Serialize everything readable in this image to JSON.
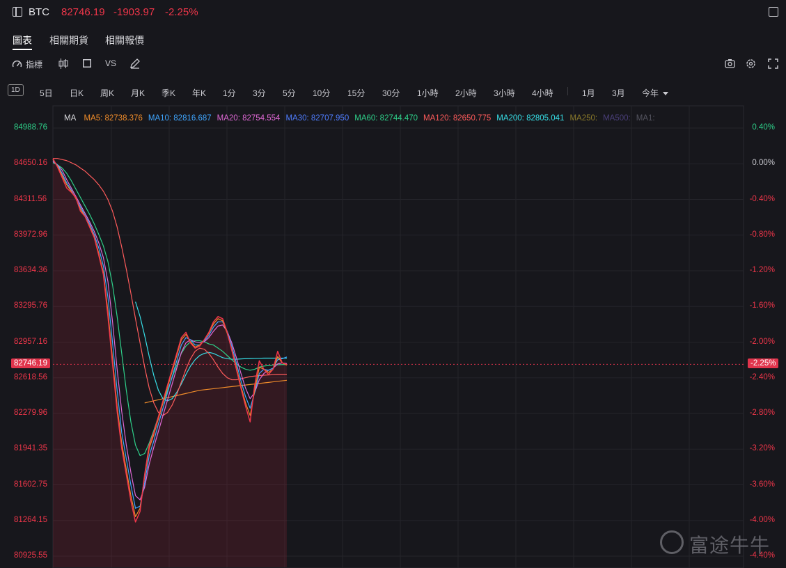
{
  "header": {
    "symbol": "BTC",
    "price": "82746.19",
    "change": "-1903.97",
    "change_pct": "-2.25%"
  },
  "tabs": [
    {
      "label": "圖表",
      "active": true
    },
    {
      "label": "相關期貨",
      "active": false
    },
    {
      "label": "相關報價",
      "active": false
    }
  ],
  "toolbar": {
    "indicator_label": "指標",
    "vs_label": "VS",
    "icons": [
      "candles-icon",
      "square-icon",
      "pen-icon",
      "camera-icon",
      "gear-icon",
      "fullscreen-icon"
    ]
  },
  "periods": [
    "1D",
    "5日",
    "日K",
    "周K",
    "月K",
    "季K",
    "年K",
    "1分",
    "3分",
    "5分",
    "10分",
    "15分",
    "30分",
    "1小時",
    "2小時",
    "3小時",
    "4小時",
    "1月",
    "3月",
    "今年"
  ],
  "legend": {
    "title": "MA",
    "items": [
      {
        "label": "MA5: 82738.376",
        "color": "#f08c2a"
      },
      {
        "label": "MA10: 82816.687",
        "color": "#3fa6ff"
      },
      {
        "label": "MA20: 82754.554",
        "color": "#e069d6"
      },
      {
        "label": "MA30: 82707.950",
        "color": "#4f7dff"
      },
      {
        "label": "MA60: 82744.470",
        "color": "#2ed18a"
      },
      {
        "label": "MA120: 82650.775",
        "color": "#ff5b5b"
      },
      {
        "label": "MA200: 82805.041",
        "color": "#37e0e8"
      },
      {
        "label": "MA250:",
        "color": "#8a7a2a"
      },
      {
        "label": "MA500:",
        "color": "#4a3f7a"
      },
      {
        "label": "MA1:",
        "color": "#555560"
      }
    ]
  },
  "current_price_tag": "82746.19",
  "current_pct_tag": "-2.25%",
  "watermark": "富途牛牛",
  "chart_data": {
    "type": "line",
    "ylim": [
      80925.55,
      84988.76
    ],
    "y_ticks_left": [
      "84988.76",
      "84650.16",
      "84311.56",
      "83972.96",
      "83634.36",
      "83295.76",
      "82957.16",
      "82618.56",
      "82279.96",
      "81941.35",
      "81602.75",
      "81264.15",
      "80925.55"
    ],
    "y_ticks_right": [
      "0.40%",
      "0.00%",
      "-0.40%",
      "-0.80%",
      "-1.20%",
      "-1.60%",
      "-2.00%",
      "-2.40%",
      "-2.80%",
      "-3.20%",
      "-3.60%",
      "-4.00%",
      "-4.40%"
    ],
    "colors": {
      "up": "#2ed18a",
      "down": "#f0364a"
    },
    "price": [
      84700,
      84620,
      84520,
      84420,
      84380,
      84330,
      84200,
      84150,
      84050,
      83950,
      83780,
      83600,
      83200,
      82750,
      82300,
      81950,
      81700,
      81450,
      81250,
      81350,
      81700,
      81980,
      82100,
      82250,
      82400,
      82550,
      82700,
      82850,
      83000,
      83050,
      82950,
      82900,
      82920,
      82980,
      83050,
      83150,
      83200,
      83180,
      83050,
      82880,
      82700,
      82520,
      82350,
      82200,
      82550,
      82780,
      82700,
      82650,
      82700,
      82870,
      82760,
      82746.19
    ],
    "ma5": [
      84690,
      84630,
      84540,
      84450,
      84390,
      84320,
      84220,
      84150,
      84060,
      83960,
      83800,
      83620,
      83250,
      82800,
      82350,
      82000,
      81750,
      81500,
      81300,
      81380,
      81680,
      81950,
      82080,
      82230,
      82380,
      82530,
      82680,
      82830,
      82980,
      83030,
      82960,
      82910,
      82930,
      82980,
      83040,
      83130,
      83180,
      83160,
      83040,
      82890,
      82720,
      82540,
      82380,
      82260,
      82500,
      82720,
      82700,
      82670,
      82700,
      82820,
      82760,
      82738.376
    ],
    "ma10": [
      84680,
      84640,
      84560,
      84470,
      84400,
      84320,
      84240,
      84160,
      84080,
      83980,
      83850,
      83680,
      83380,
      82950,
      82500,
      82100,
      81850,
      81600,
      81380,
      81400,
      81620,
      81880,
      82020,
      82180,
      82330,
      82480,
      82630,
      82780,
      82930,
      83000,
      82980,
      82930,
      82930,
      82970,
      83020,
      83100,
      83150,
      83150,
      83060,
      82920,
      82760,
      82590,
      82440,
      82330,
      82480,
      82660,
      82700,
      82690,
      82710,
      82790,
      82800,
      82816.687
    ],
    "ma20": [
      84670,
      84640,
      84590,
      84500,
      84420,
      84340,
      84260,
      84180,
      84100,
      84010,
      83900,
      83760,
      83530,
      83150,
      82700,
      82300,
      81980,
      81720,
      81500,
      81460,
      81580,
      81800,
      81960,
      82110,
      82260,
      82410,
      82560,
      82710,
      82860,
      82950,
      82980,
      82960,
      82950,
      82960,
      83000,
      83060,
      83110,
      83120,
      83060,
      82950,
      82810,
      82660,
      82520,
      82420,
      82480,
      82600,
      82660,
      82690,
      82710,
      82750,
      82760,
      82754.554
    ],
    "ma60": [
      84660,
      84640,
      84610,
      84560,
      84490,
      84410,
      84330,
      84250,
      84170,
      84080,
      83980,
      83870,
      83720,
      83500,
      83200,
      82850,
      82500,
      82200,
      81980,
      81880,
      81900,
      82000,
      82120,
      82250,
      82380,
      82500,
      82620,
      82740,
      82850,
      82920,
      82960,
      82970,
      82970,
      82960,
      82940,
      82930,
      82900,
      82870,
      82830,
      82790,
      82750,
      82720,
      82700,
      82690,
      82700,
      82720,
      82730,
      82735,
      82740,
      82742,
      82744,
      82744.47
    ],
    "ma120": [
      84700,
      84700,
      84690,
      84680,
      84660,
      84640,
      84610,
      84580,
      84540,
      84500,
      84450,
      84390,
      84310,
      84200,
      84050,
      83860,
      83650,
      83420,
      83180,
      82950,
      82720,
      82520,
      82380,
      82290,
      82260,
      82290,
      82360,
      82460,
      82580,
      82700,
      82800,
      82870,
      82900,
      82890,
      82850,
      82790,
      82720,
      82660,
      82620,
      82600,
      82600,
      82610,
      82620,
      82630,
      82635,
      82640,
      82643,
      82646,
      82648,
      82650,
      82650,
      82650.775
    ],
    "ma200": [
      null,
      null,
      null,
      null,
      null,
      null,
      null,
      null,
      null,
      null,
      null,
      null,
      null,
      null,
      null,
      null,
      null,
      null,
      83340,
      83200,
      83020,
      82820,
      82640,
      82500,
      82420,
      82400,
      82420,
      82480,
      82560,
      82650,
      82730,
      82790,
      82830,
      82850,
      82860,
      82850,
      82830,
      82810,
      82800,
      82795,
      82795,
      82798,
      82800,
      82802,
      82803,
      82804,
      82805,
      82805,
      82805,
      82805,
      82805,
      82805.041
    ],
    "ma_flat": [
      null,
      null,
      null,
      null,
      null,
      null,
      null,
      null,
      null,
      null,
      null,
      null,
      null,
      null,
      null,
      null,
      null,
      null,
      null,
      null,
      82380,
      82390,
      82400,
      82410,
      82420,
      82430,
      82440,
      82450,
      82460,
      82470,
      82480,
      82490,
      82500,
      82505,
      82510,
      82515,
      82520,
      82525,
      82530,
      82535,
      82540,
      82545,
      82550,
      82555,
      82560,
      82565,
      82570,
      82575,
      82580,
      82585,
      82590,
      82595
    ]
  }
}
